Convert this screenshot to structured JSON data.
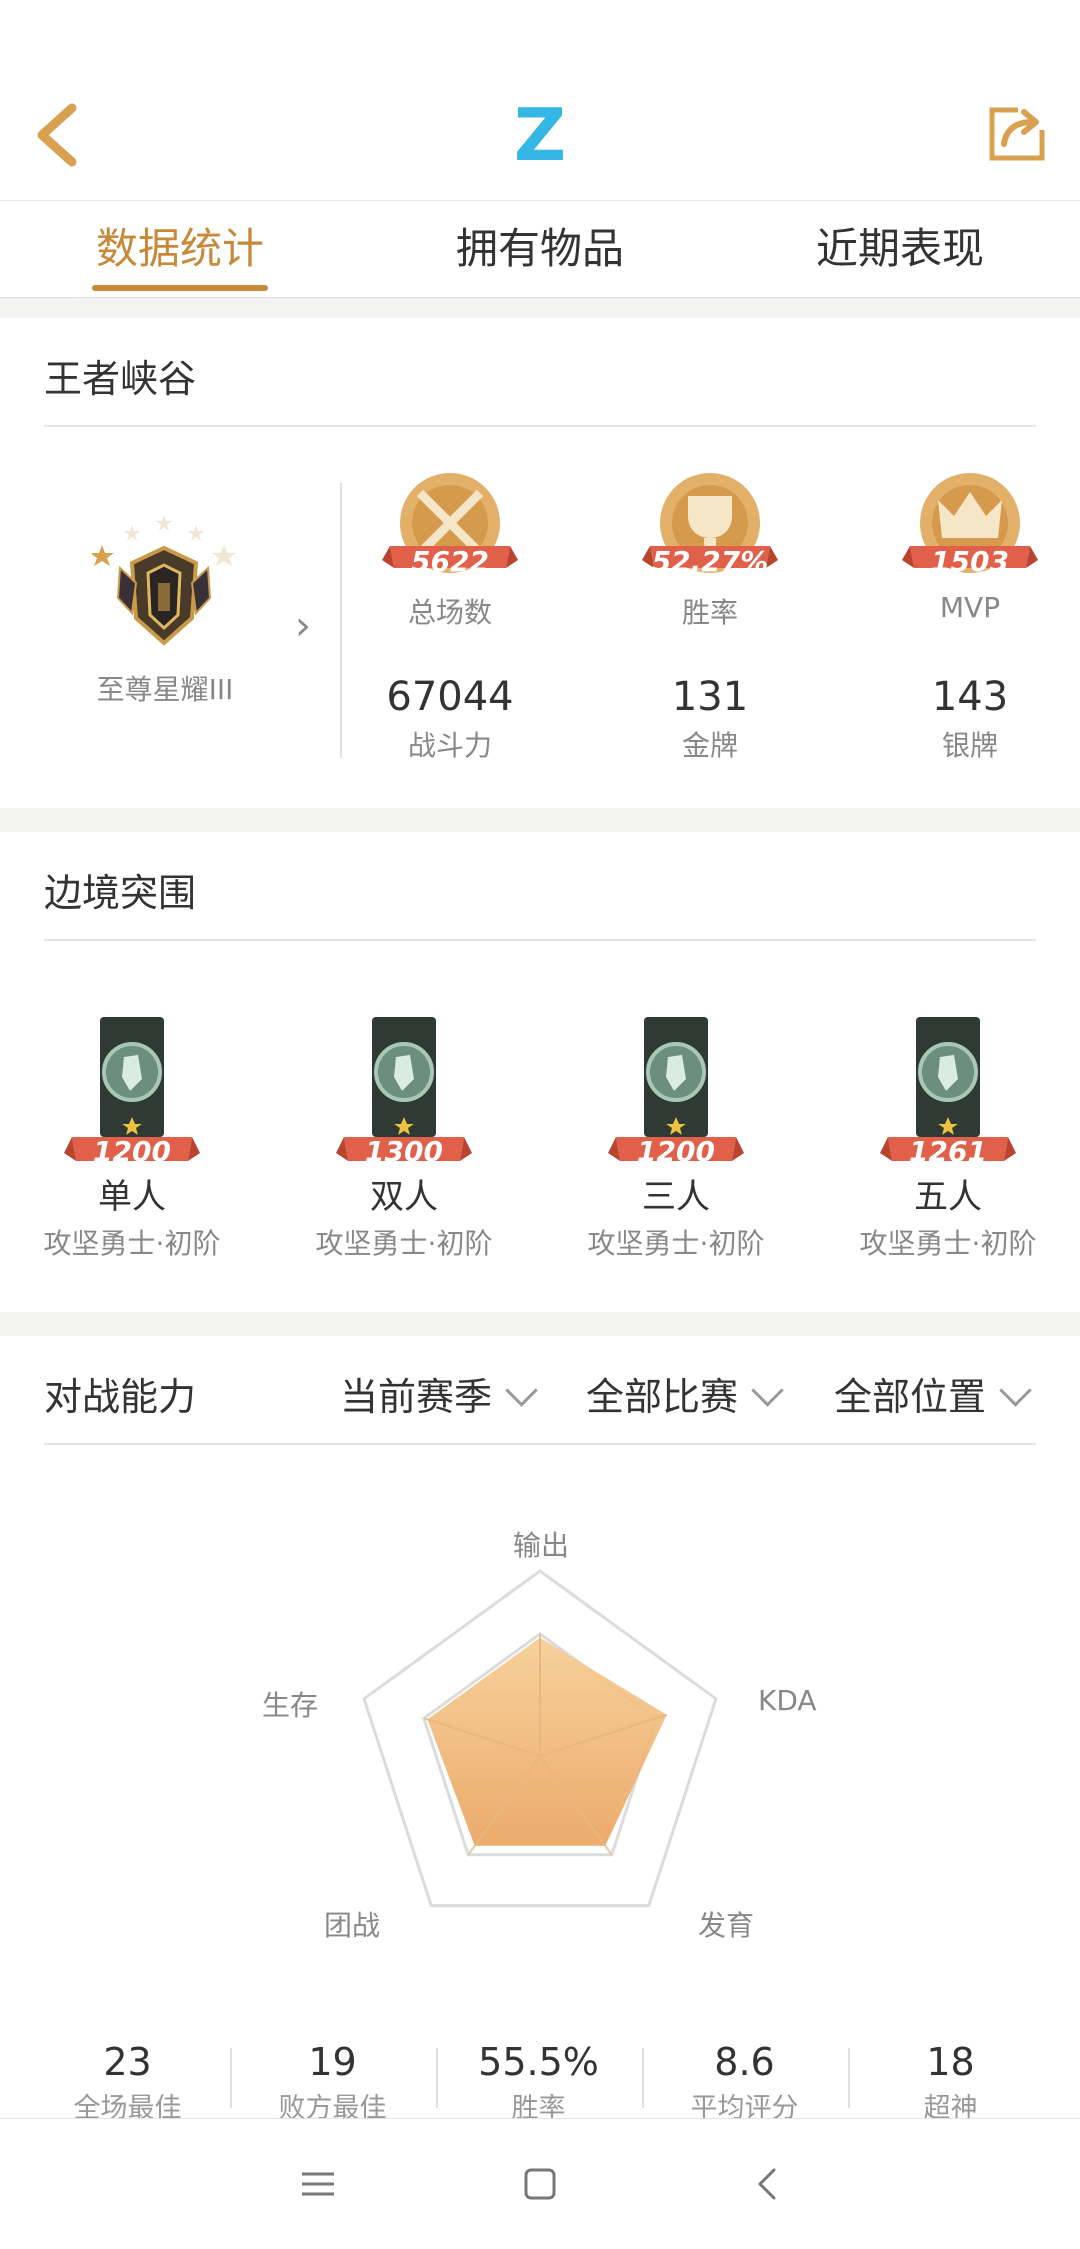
{
  "header": {
    "logo": "Z"
  },
  "tabs": [
    {
      "label": "数据统计",
      "active": true
    },
    {
      "label": "拥有物品",
      "active": false
    },
    {
      "label": "近期表现",
      "active": false
    }
  ],
  "kings_canyon": {
    "title": "王者峡谷",
    "rank_name": "至尊星耀III",
    "badges": [
      {
        "value": "5622",
        "label": "总场数"
      },
      {
        "value": "52.27%",
        "label": "胜率"
      },
      {
        "value": "1503",
        "label": "MVP"
      }
    ],
    "stats": [
      {
        "value": "67044",
        "label": "战斗力"
      },
      {
        "value": "131",
        "label": "金牌"
      },
      {
        "value": "143",
        "label": "银牌"
      }
    ]
  },
  "border_breakout": {
    "title": "边境突围",
    "modes": [
      {
        "score": "1200",
        "name": "单人",
        "rank": "攻坚勇士·初阶"
      },
      {
        "score": "1300",
        "name": "双人",
        "rank": "攻坚勇士·初阶"
      },
      {
        "score": "1200",
        "name": "三人",
        "rank": "攻坚勇士·初阶"
      },
      {
        "score": "1261",
        "name": "五人",
        "rank": "攻坚勇士·初阶"
      }
    ]
  },
  "combat": {
    "title": "对战能力",
    "filters": [
      "当前赛季",
      "全部比赛",
      "全部位置"
    ],
    "radar": {
      "axes": [
        "输出",
        "KDA",
        "发育",
        "团战",
        "生存"
      ],
      "values": [
        0.64,
        0.72,
        0.6,
        0.6,
        0.64
      ]
    },
    "summary": [
      {
        "value": "23",
        "label": "全场最佳"
      },
      {
        "value": "19",
        "label": "败方最佳"
      },
      {
        "value": "55.5%",
        "label": "胜率"
      },
      {
        "value": "8.6",
        "label": "平均评分"
      },
      {
        "value": "18",
        "label": "超神"
      }
    ]
  },
  "colors": {
    "accent": "#c9893a",
    "logo": "#35b7e6",
    "ribbon": "#e0604a",
    "radar_fill": "#f0b26b"
  }
}
